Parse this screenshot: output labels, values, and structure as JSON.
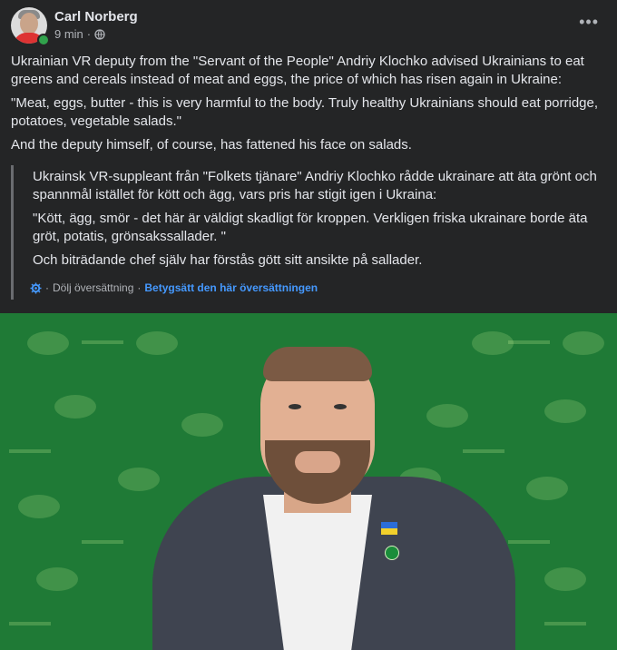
{
  "post": {
    "author": "Carl Norberg",
    "time": "9 min",
    "separator": "·",
    "more": "•••",
    "paragraphs": [
      "Ukrainian VR deputy from the \"Servant of the People\" Andriy Klochko advised Ukrainians to eat greens and cereals instead of meat and eggs, the price of which has risen again in Ukraine:",
      "\"Meat, eggs, butter - this is very harmful to the body. Truly healthy Ukrainians should eat porridge, potatoes, vegetable salads.\"",
      "And the deputy himself, of course, has fattened his face on salads."
    ]
  },
  "translation": {
    "paragraphs": [
      "Ukrainsk VR-suppleant från \"Folkets tjänare\" Andriy Klochko rådde ukrainare att äta grönt och spannmål istället för kött och ägg, vars pris har stigit igen i Ukraina:",
      "\"Kött, ägg, smör - det här är väldigt skadligt för kroppen. Verkligen friska ukrainare borde äta gröt, potatis, grönsakssallader. \"",
      "Och biträdande chef själv har förstås gött sitt ansikte på sallader."
    ],
    "sep1": "·",
    "hide_label": "Dölj översättning",
    "sep2": "·",
    "rate_label": "Betygsätt den här översättningen"
  },
  "colors": {
    "background": "#242526",
    "text": "#e4e6eb",
    "muted": "#b0b3b8",
    "link": "#4599ff",
    "photo_bg": "#1f7a36"
  },
  "icons": [
    "globe-icon",
    "gear-icon",
    "more-options-icon"
  ]
}
